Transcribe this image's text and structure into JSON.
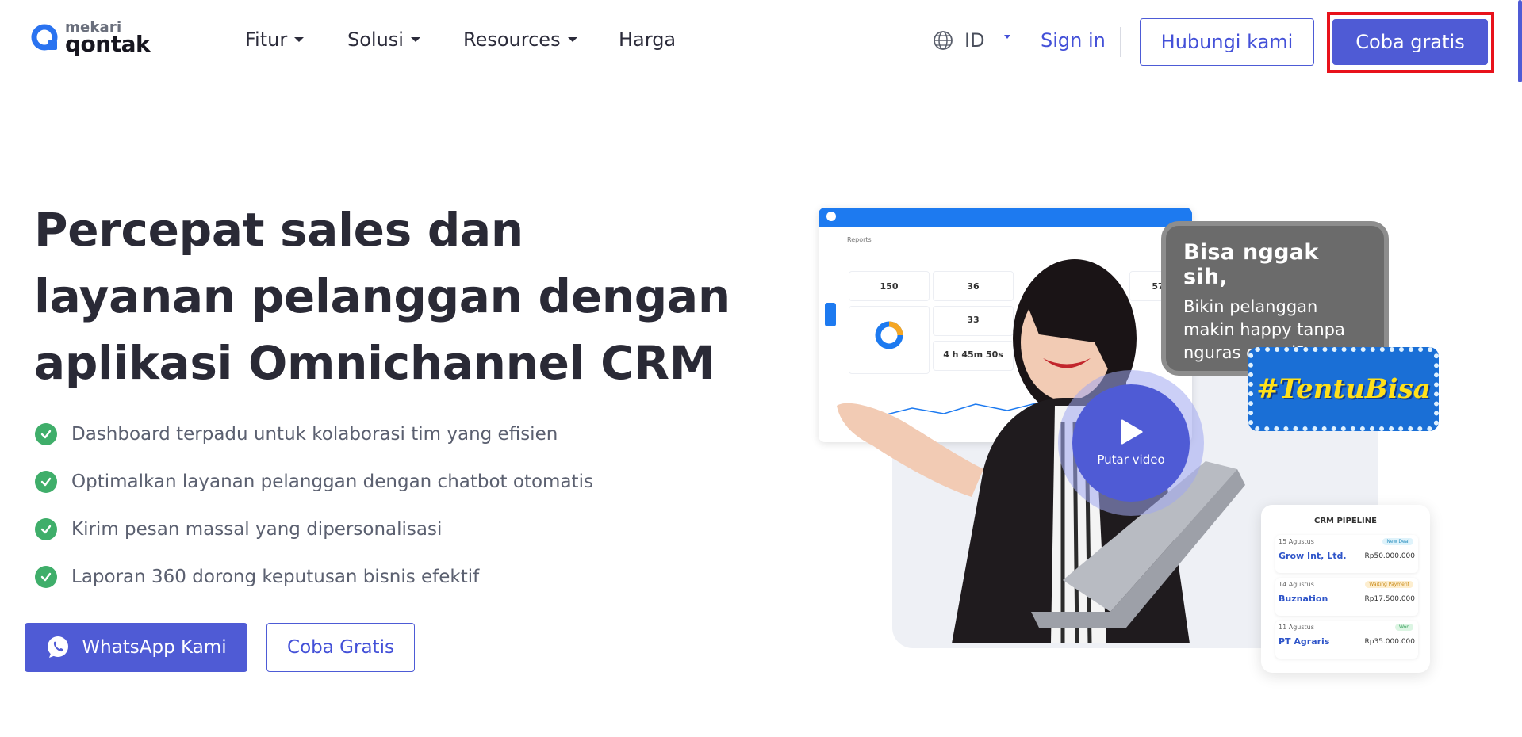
{
  "header": {
    "logo": {
      "small": "mekari",
      "big": "qontak"
    },
    "nav": [
      {
        "label": "Fitur",
        "has_dropdown": true
      },
      {
        "label": "Solusi",
        "has_dropdown": true
      },
      {
        "label": "Resources",
        "has_dropdown": true
      },
      {
        "label": "Harga",
        "has_dropdown": false
      }
    ],
    "language": {
      "icon": "globe-icon",
      "value": "ID"
    },
    "sign_in": "Sign in",
    "contact_button": "Hubungi kami",
    "trial_button": "Coba gratis"
  },
  "hero": {
    "title": "Percepat sales dan layanan pelanggan dengan aplikasi Omnichannel CRM",
    "bullets": [
      "Dashboard terpadu untuk kolaborasi tim yang efisien",
      "Optimalkan layanan pelanggan dengan chatbot otomatis",
      "Kirim pesan massal yang dipersonalisasi",
      "Laporan 360 dorong keputusan bisnis efektif"
    ],
    "whatsapp_button": "WhatsApp Kami",
    "trial_button": "Coba Gratis"
  },
  "visual": {
    "dashboard": {
      "title": "Reports",
      "stats": [
        {
          "value": "150"
        },
        {
          "value": "36"
        },
        {
          "value": "57"
        },
        {
          "value": "33"
        },
        {
          "value": "4 h 45m 50s"
        }
      ]
    },
    "speech_bubble": {
      "title": "Bisa nggak sih,",
      "text": "Bikin pelanggan makin happy tanpa nguras emosi?"
    },
    "banner": "#TentuBisa",
    "play_button": "Putar video",
    "crm": {
      "title": "CRM PIPELINE",
      "rows": [
        {
          "date": "15 Agustus",
          "company": "Grow Int, Ltd.",
          "amount": "Rp50.000.000",
          "tag": "New Deal"
        },
        {
          "date": "14 Agustus",
          "company": "Buznation",
          "amount": "Rp17.500.000",
          "tag": "Waiting Payment"
        },
        {
          "date": "11 Agustus",
          "company": "PT Agraris",
          "amount": "Rp35.000.000",
          "tag": "Won"
        }
      ]
    }
  },
  "colors": {
    "brand": "#4F5BD5",
    "check": "#3FAE6A",
    "highlight": "#E8121B",
    "dashboard_bar": "#1D7AF0"
  }
}
